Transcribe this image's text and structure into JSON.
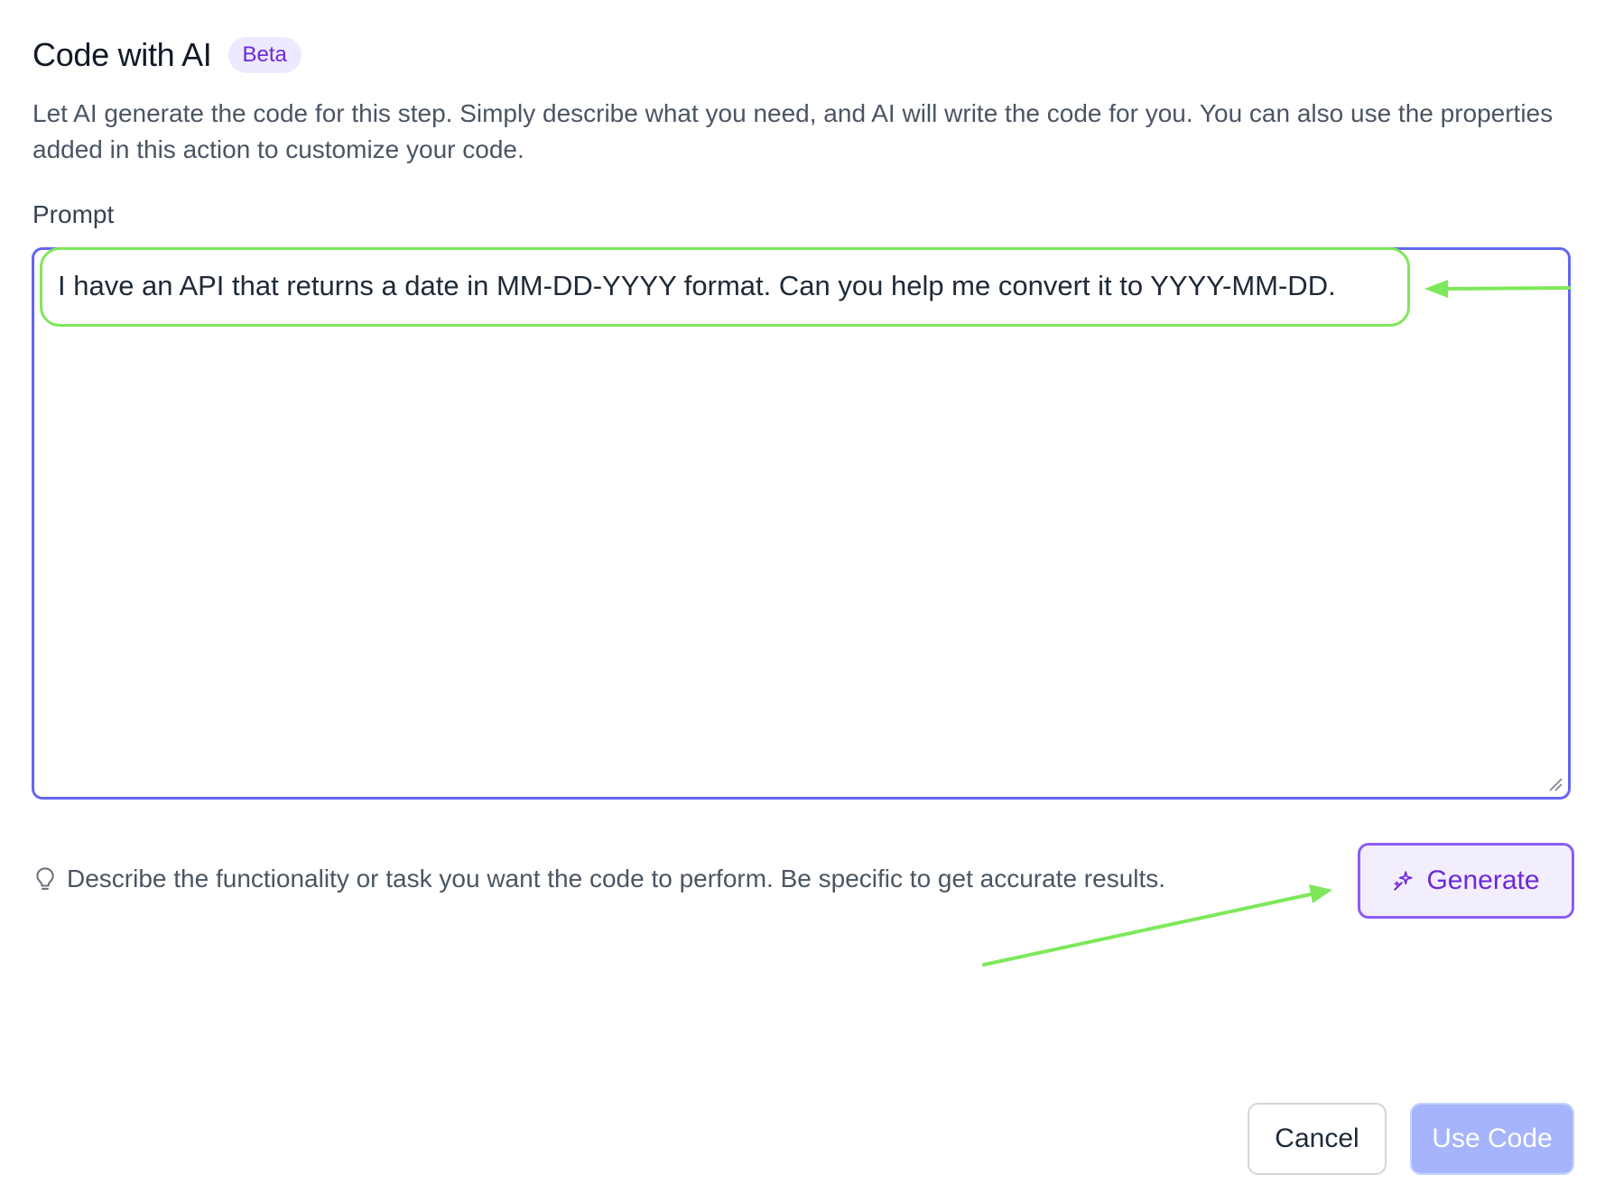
{
  "dialog": {
    "title": "Code with AI",
    "badge": "Beta",
    "description": "Let AI generate the code for this step. Simply describe what you need, and AI will write the code for you. You can also use the properties added in this action to customize your code."
  },
  "prompt": {
    "label": "Prompt",
    "value": "I have an API that returns a date in MM-DD-YYYY format. Can you help me convert it to YYYY-MM-DD."
  },
  "hint": {
    "icon": "lightbulb-icon",
    "text": "Describe the functionality or task you want the code to perform. Be specific to get accurate results."
  },
  "generate": {
    "icon": "sparkle-icon",
    "label": "Generate"
  },
  "footer": {
    "cancel_label": "Cancel",
    "use_code_label": "Use Code"
  },
  "colors": {
    "accent": "#6366f1",
    "badge_bg": "#ede9fe",
    "badge_text": "#6d28d9",
    "generate_border": "#8b5cf6",
    "use_code_bg": "#a5b4fc",
    "annotation": "#7ee85a"
  }
}
